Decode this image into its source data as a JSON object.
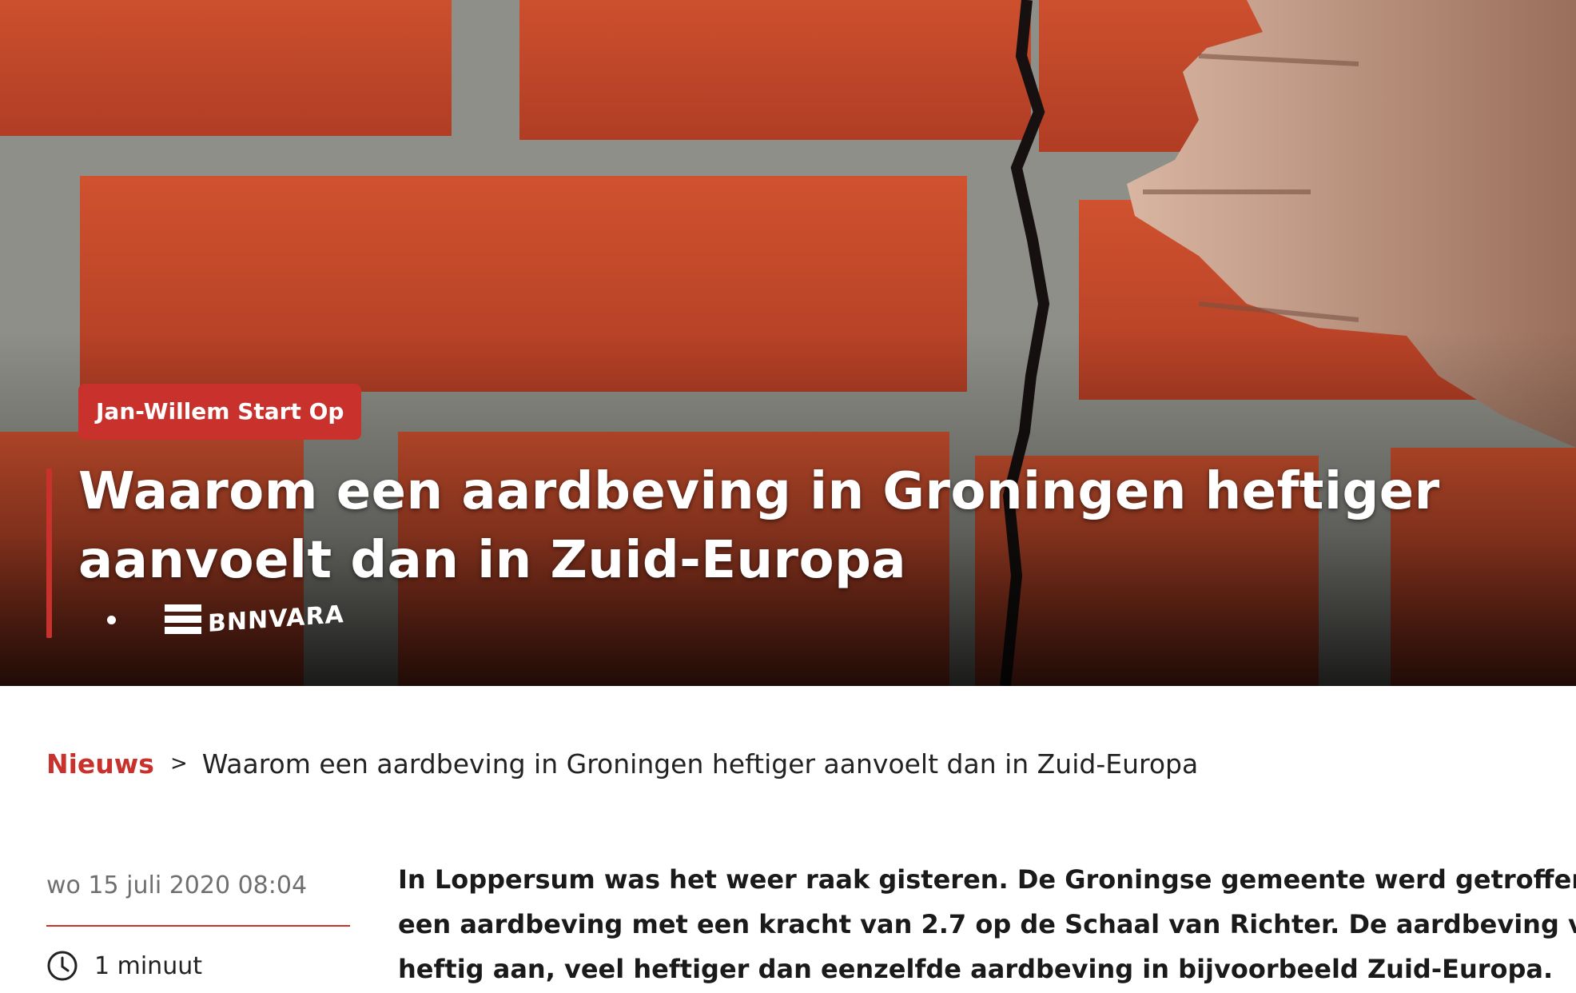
{
  "hero": {
    "tag": "Jan-Willem Start Op",
    "title_line1": "Waarom een aardbeving in Groningen heftiger",
    "title_line2": "aanvoelt dan in Zuid-Europa",
    "brand": "BNNVARA",
    "image_subject": "cracked red brick wall with hand"
  },
  "breadcrumb": {
    "home": "Nieuws",
    "separator": ">",
    "current": "Waarom een aardbeving in Groningen heftiger aanvoelt dan in Zuid-Europa"
  },
  "meta": {
    "date": "wo 15 juli 2020 08:04",
    "read_time": "1 minuut",
    "read_time_icon": "clock-icon"
  },
  "article": {
    "lead_line1": "In Loppersum was het weer raak gisteren. De Groningse gemeente werd getroffen doo",
    "lead_line2": "een aardbeving met een kracht van 2.7 op de Schaal van Richter. De aardbeving voeld",
    "lead_line3": "heftig aan, veel heftiger dan eenzelfde aardbeving in bijvoorbeeld Zuid-Europa."
  },
  "colors": {
    "accent": "#c8312c",
    "brick": "#c4482c",
    "mortar": "#9a9a94",
    "text": "#1a1a1a",
    "muted": "#6f6f6f"
  }
}
